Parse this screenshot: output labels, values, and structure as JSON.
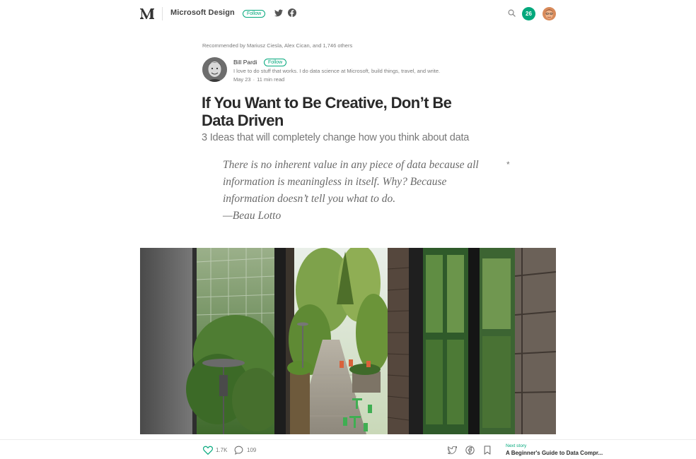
{
  "header": {
    "publication_name": "Microsoft Design",
    "follow_label": "Follow",
    "notification_count": "26"
  },
  "article": {
    "recommended_by": "Recommended by Mariusz Ciesla, Alex Cican, and 1,746 others",
    "author": {
      "name": "Bill Pardi",
      "follow_label": "Follow",
      "bio": "I love to do stuff that works. I do data science at Microsoft, build things, travel, and write.",
      "date": "May 23",
      "read_time": "11 min read",
      "separator": "·"
    },
    "title_line1": "If You Want to Be Creative, Don’t Be",
    "title_line2": "Data Driven",
    "subtitle": "3 Ideas that will completely change how you think about data",
    "quote": {
      "line1": "There is no inherent value in any piece of data because all",
      "line2": "information is meaningless in itself. Why? Because",
      "line3": "information doesn’t tell you what to do.",
      "attribution": "—Beau Lotto",
      "marker": "*"
    }
  },
  "footer": {
    "claps": "1.7K",
    "responses": "109",
    "next_story_label": "Next story",
    "next_story_title": "A Beginner's Guide to Data Compr..."
  },
  "colors": {
    "accent": "#03a87c",
    "text_primary": "rgba(0,0,0,0.84)",
    "text_secondary": "rgba(0,0,0,0.54)"
  },
  "icons": {
    "logo": "medium-logo-icon",
    "twitter": "twitter-icon",
    "facebook": "facebook-icon",
    "search": "search-icon",
    "clap": "heart-icon",
    "response": "speech-bubble-icon",
    "bookmark": "bookmark-icon"
  }
}
